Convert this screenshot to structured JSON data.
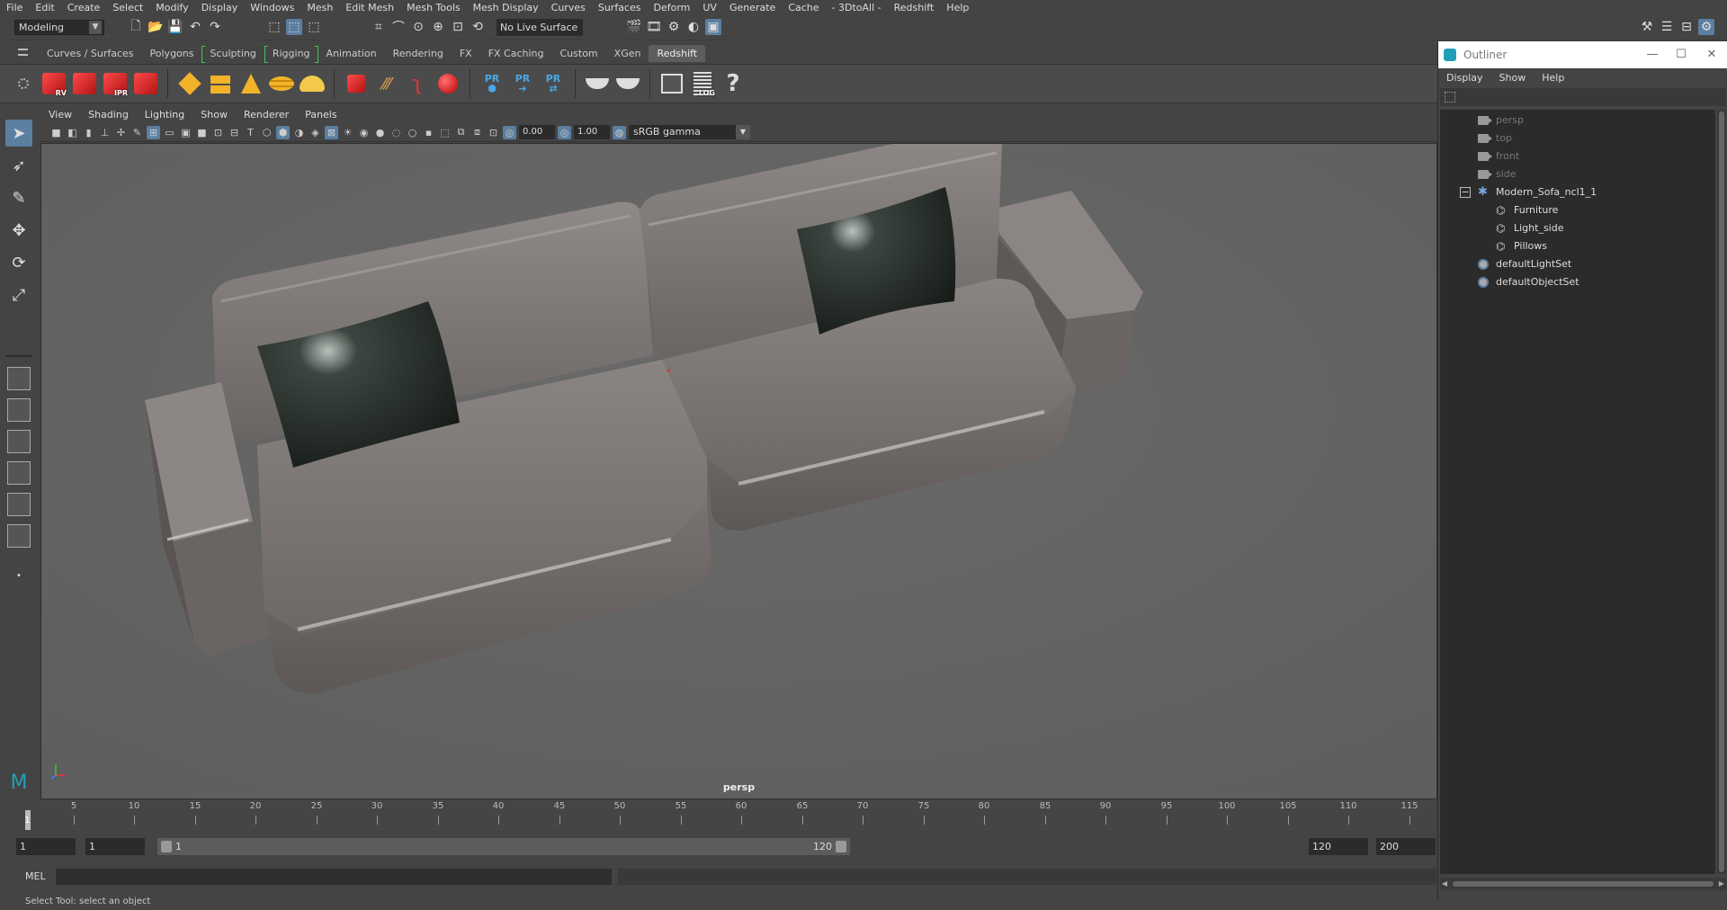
{
  "menubar": [
    "File",
    "Edit",
    "Create",
    "Select",
    "Modify",
    "Display",
    "Windows",
    "Mesh",
    "Edit Mesh",
    "Mesh Tools",
    "Mesh Display",
    "Curves",
    "Surfaces",
    "Deform",
    "UV",
    "Generate",
    "Cache",
    "- 3DtoAll -",
    "Redshift",
    "Help"
  ],
  "status_line": {
    "mode": "Modeling",
    "live_surface": "No Live Surface"
  },
  "shelf_tabs": [
    "Curves / Surfaces",
    "Polygons",
    "Sculpting",
    "Rigging",
    "Animation",
    "Rendering",
    "FX",
    "FX Caching",
    "Custom",
    "XGen",
    "Redshift"
  ],
  "active_shelf_tab": "Redshift",
  "shelf": {
    "rv_label": "RV",
    "ipr_label": "IPR",
    "pr_label": "PR",
    "log_label": "LOG",
    "help_glyph": "?"
  },
  "panel_menu": [
    "View",
    "Shading",
    "Lighting",
    "Show",
    "Renderer",
    "Panels"
  ],
  "panel_toolbar": {
    "exposure": "0.00",
    "gamma": "1.00",
    "color_space": "sRGB gamma"
  },
  "viewport": {
    "camera": "persp"
  },
  "time_slider": {
    "ticks": [
      "5",
      "10",
      "15",
      "20",
      "25",
      "30",
      "35",
      "40",
      "45",
      "50",
      "55",
      "60",
      "65",
      "70",
      "75",
      "80",
      "85",
      "90",
      "95",
      "100",
      "105",
      "110",
      "115"
    ],
    "current_frame": "1"
  },
  "range_slider": {
    "start_field": "1",
    "playback_start": "1",
    "range_start": "1",
    "range_end": "120",
    "playback_end": "120",
    "end_field": "200"
  },
  "command_line": {
    "label": "MEL"
  },
  "help_line": "Select Tool: select an object",
  "outliner": {
    "title": "Outliner",
    "menu": [
      "Display",
      "Show",
      "Help"
    ],
    "rows": {
      "persp": "persp",
      "top": "top",
      "front": "front",
      "side": "side",
      "group": "Modern_Sofa_ncl1_1",
      "furniture": "Furniture",
      "light_side": "Light_side",
      "pillows": "Pillows",
      "light_set": "defaultLightSet",
      "object_set": "defaultObjectSet"
    }
  },
  "colors": {
    "accent": "#5b7fa0",
    "viewport_bg": "#646464",
    "sofa": "#7b7673",
    "pillow": "#1d2420"
  }
}
